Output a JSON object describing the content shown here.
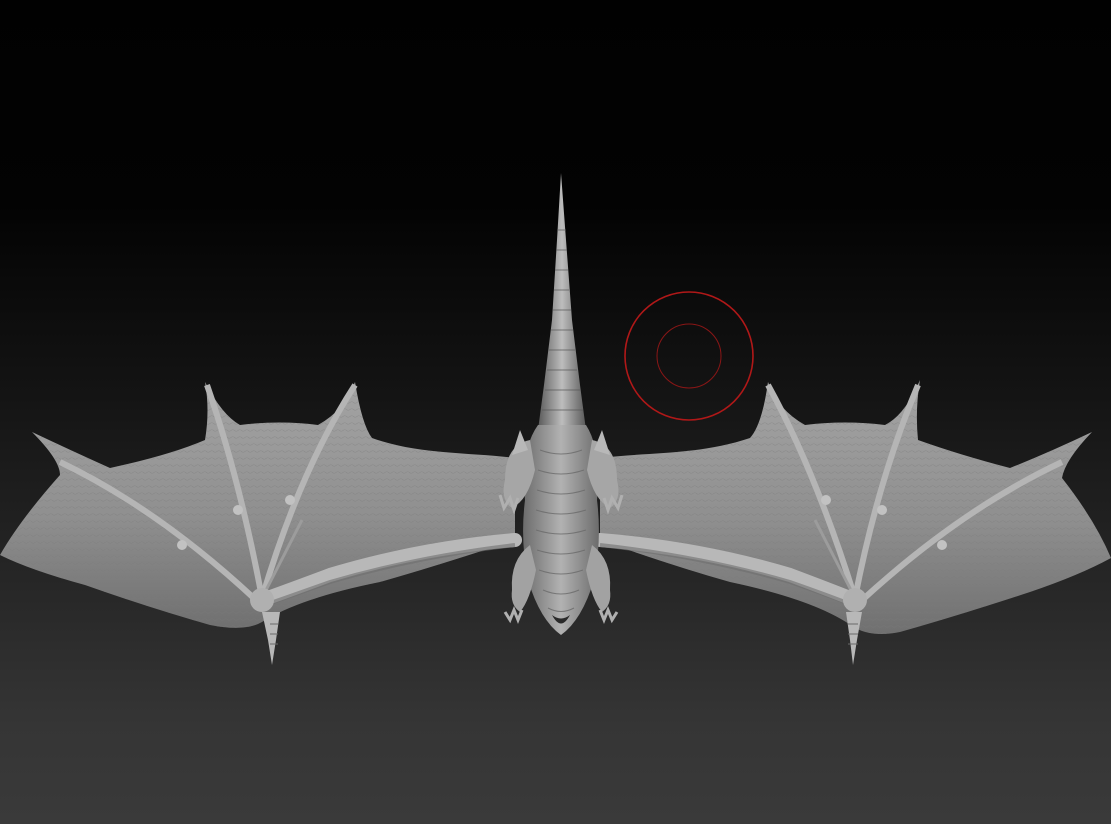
{
  "viewport": {
    "background_top": "#010101",
    "background_bottom": "#3a3a3a"
  },
  "model": {
    "subject": "dragon-sculpt",
    "material_color": "#9a9a9a",
    "material_shadow": "#5e5e5e",
    "material_highlight": "#c4c4c4"
  },
  "brush_cursor": {
    "color": "#b01818",
    "icon": "brush-draw-size-circle"
  }
}
